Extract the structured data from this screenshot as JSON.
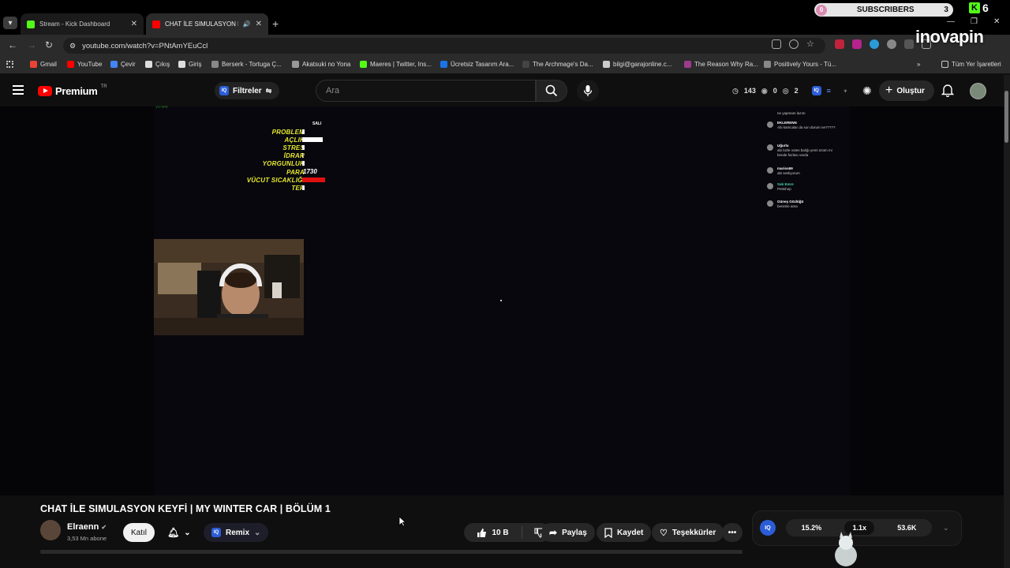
{
  "browser": {
    "tabs": [
      {
        "title": "Stream - Kick Dashboard",
        "favicon_color": "#53fc18"
      },
      {
        "title": "CHAT İLE SIMULASYON KE",
        "favicon_color": "#ff0000"
      }
    ],
    "url": "youtube.com/watch?v=PNtAmYEuCcl",
    "subscribers_widget": {
      "count_left": "0",
      "label": "SUBSCRIBERS",
      "count_right": "3"
    },
    "kick_count": "6",
    "watermark": "inovapin",
    "bookmarks": [
      {
        "label": "Gmail",
        "color": "#ea4335"
      },
      {
        "label": "YouTube",
        "color": "#ff0000"
      },
      {
        "label": "Çevir",
        "color": "#4285f4"
      },
      {
        "label": "Çıkış",
        "color": "#dddddd"
      },
      {
        "label": "Giriş",
        "color": "#dddddd"
      },
      {
        "label": "Berserk - Tortuga Ç...",
        "color": "#888888"
      },
      {
        "label": "Akatsuki no Yona",
        "color": "#999999"
      },
      {
        "label": "Maeres | Twitter, Ins...",
        "color": "#53fc18"
      },
      {
        "label": "Ücretsiz Tasarım Ara...",
        "color": "#1a73e8"
      },
      {
        "label": "The Archmage's Da...",
        "color": "#444444"
      },
      {
        "label": "bilgi@garajonline.c...",
        "color": "#cccccc"
      },
      {
        "label": "The Reason Why Ra...",
        "color": "#9b3c8c"
      },
      {
        "label": "Positively Yours - Tü...",
        "color": "#888888"
      }
    ],
    "bookmarks_more": "»",
    "all_bookmarks": "Tüm Yer İşaretleri"
  },
  "youtube": {
    "logo_text": "Premium",
    "logo_sup": "TR",
    "filters_label": "Filtreler",
    "search_placeholder": "Ara",
    "stats": {
      "views": "143",
      "eye": "0",
      "watching": "2"
    },
    "create_label": "Oluştur"
  },
  "overlay": {
    "fps": "177 FPS",
    "day": "SALI",
    "stats": [
      {
        "label": "PROBLEM",
        "level": 0.12,
        "color": "#ffffff"
      },
      {
        "label": "AÇLIK",
        "level": 0.9,
        "color": "#ffffff"
      },
      {
        "label": "STRES",
        "level": 0.12,
        "color": "#ffffff"
      },
      {
        "label": "İDRAR",
        "level": 0.03,
        "color": "#ffffff"
      },
      {
        "label": "YORGUNLUK",
        "level": 0.12,
        "color": "#ffffff"
      },
      {
        "label": "PARA",
        "value": "1730"
      },
      {
        "label": "VÜCUT SICAKLIĞI",
        "level": 1.0,
        "color": "#e01010"
      },
      {
        "label": "TER",
        "level": 0.12,
        "color": "#ffffff"
      }
    ],
    "chat": [
      {
        "user": "",
        "msg": "ne yapmam lazım"
      },
      {
        "user": "EKLERENN",
        "msg": "Abi kamcalar da son durum ne?????"
      },
      {
        "user": "Uğurlu",
        "msg": "abi bizle votes balığı yemi üzüm mi bende fazlası varda"
      },
      {
        "user": "marios69",
        "msg": "abi sesliyorum"
      },
      {
        "user": "Sab Emre",
        "msg": "Pettshop"
      },
      {
        "user": "Güneş Gözlüğü",
        "msg": "benimle ama"
      }
    ]
  },
  "video": {
    "title": "CHAT İLE SIMULASYON KEYFİ | MY WINTER CAR | BÖLÜM 1",
    "channel": "Elraenn",
    "subscribers": "3,53 Mn abone",
    "join_label": "Katıl",
    "remix_label": "Remix",
    "likes": "10 B",
    "share_label": "Paylaş",
    "save_label": "Kaydet",
    "thanks_label": "Teşekkürler"
  },
  "iq_panel": {
    "badge": "IQ",
    "stat1": "15.2%",
    "stat2": "1.1x",
    "stat3": "53.6K"
  }
}
